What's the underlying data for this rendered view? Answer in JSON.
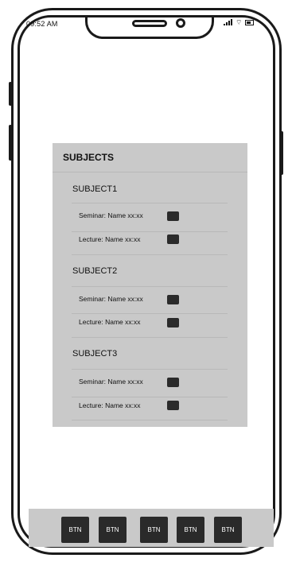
{
  "status_bar": {
    "time": "09:52 AM",
    "icons": [
      "signal-icon",
      "wifi-icon",
      "battery-icon"
    ]
  },
  "panel": {
    "title": "SUBJECTS",
    "subjects": [
      {
        "title": "SUBJECT1",
        "items": [
          "Seminar: Name xx:xx",
          "Lecture: Name xx:xx"
        ]
      },
      {
        "title": "SUBJECT2",
        "items": [
          "Seminar: Name xx:xx",
          "Lecture: Name xx:xx"
        ]
      },
      {
        "title": "SUBJECT3",
        "items": [
          "Seminar: Name xx:xx",
          "Lecture: Name xx:xx"
        ]
      }
    ]
  },
  "bottom_nav": {
    "buttons": [
      "BTN",
      "BTN",
      "BTN",
      "BTN",
      "BTN"
    ]
  },
  "colors": {
    "panel_bg": "#c9c9c9",
    "button_bg": "#2a2a2a",
    "outline": "#1a1a1a"
  }
}
